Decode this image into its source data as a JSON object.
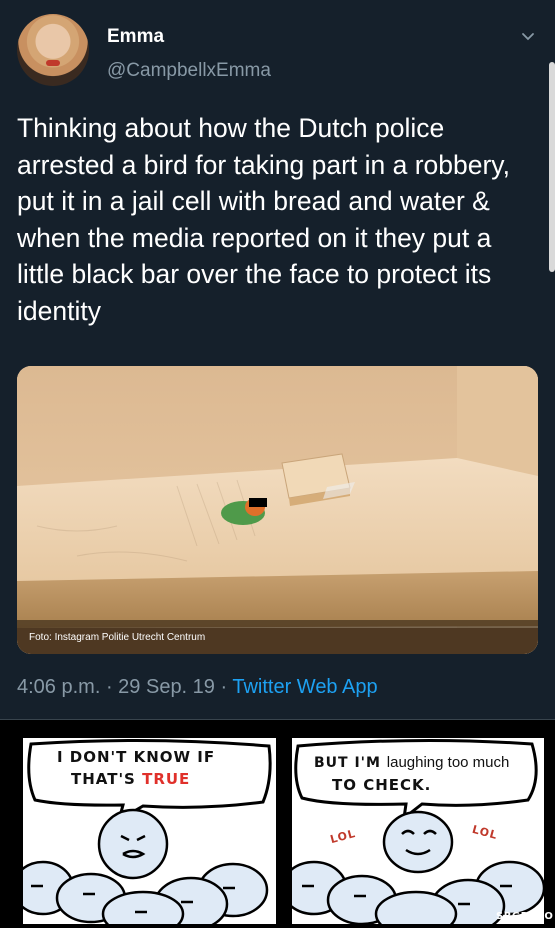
{
  "tweet": {
    "display_name": "Emma",
    "handle": "@CampbellxEmma",
    "text": "Thinking about how the Dutch police arrested a bird for taking part in a robbery, put it in a jail cell with bread and water & when the media reported on it they put a little black bar over the face to protect its identity",
    "photo_caption": "Foto: Instagram Politie Utrecht Centrum",
    "time": "4:06 p.m.",
    "date": "29 Sep. 19",
    "app": "Twitter Web App",
    "separator": " · "
  },
  "comic": {
    "left_panel": {
      "line1": "I DON'T KNOW IF",
      "line2_a": "THAT'S ",
      "line2_b": "TRUE"
    },
    "right_panel": {
      "line1_a": "BUT I'M ",
      "line1_b": "laughing too much",
      "line2": "TO CHECK."
    },
    "lol_labels": [
      "LOL",
      "LOL"
    ],
    "credit": "SRGRAFO"
  },
  "colors": {
    "background": "#15202b",
    "link": "#1da1f2",
    "secondary": "#8899a6",
    "true_red": "#e0302a"
  },
  "icons": [
    "chevron-down-icon"
  ]
}
